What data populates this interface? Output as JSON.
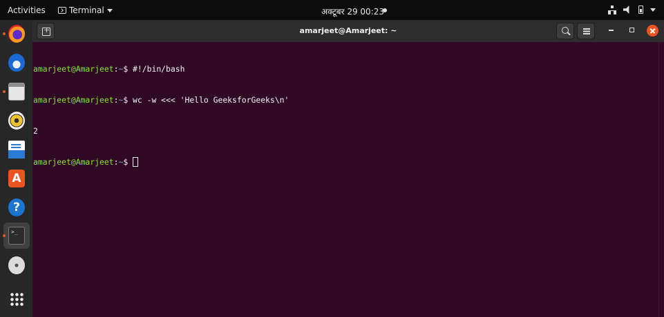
{
  "topbar": {
    "activities": "Activities",
    "app_name": "Terminal",
    "clock": "अक्टूबर 29  00:23"
  },
  "dock": {
    "items": [
      {
        "name": "Firefox Web Browser",
        "running": true
      },
      {
        "name": "Thunderbird Mail",
        "running": false
      },
      {
        "name": "Files",
        "running": true
      },
      {
        "name": "Rhythmbox",
        "running": false
      },
      {
        "name": "LibreOffice Writer",
        "running": false
      },
      {
        "name": "Ubuntu Software",
        "running": false
      },
      {
        "name": "Help",
        "running": false
      },
      {
        "name": "Terminal",
        "running": true,
        "active": true
      },
      {
        "name": "DVD",
        "running": false
      },
      {
        "name": "Show Applications",
        "running": false
      }
    ],
    "software_glyph": "A",
    "help_glyph": "?",
    "terminal_glyph": ">_"
  },
  "window": {
    "title": "amarjeet@Amarjeet: ~"
  },
  "terminal": {
    "prompt_user": "amarjeet@Amarjeet",
    "prompt_sep": ":",
    "prompt_path": "~",
    "prompt_symbol": "$ ",
    "lines": [
      {
        "command": "#!/bin/bash"
      },
      {
        "command": "wc -w <<< 'Hello GeeksforGeeks\\n'"
      },
      {
        "output": "2"
      }
    ]
  },
  "colors": {
    "terminal_bg": "#300a24",
    "prompt_user": "#8ae234",
    "prompt_path": "#729fcf",
    "accent": "#e95420"
  }
}
